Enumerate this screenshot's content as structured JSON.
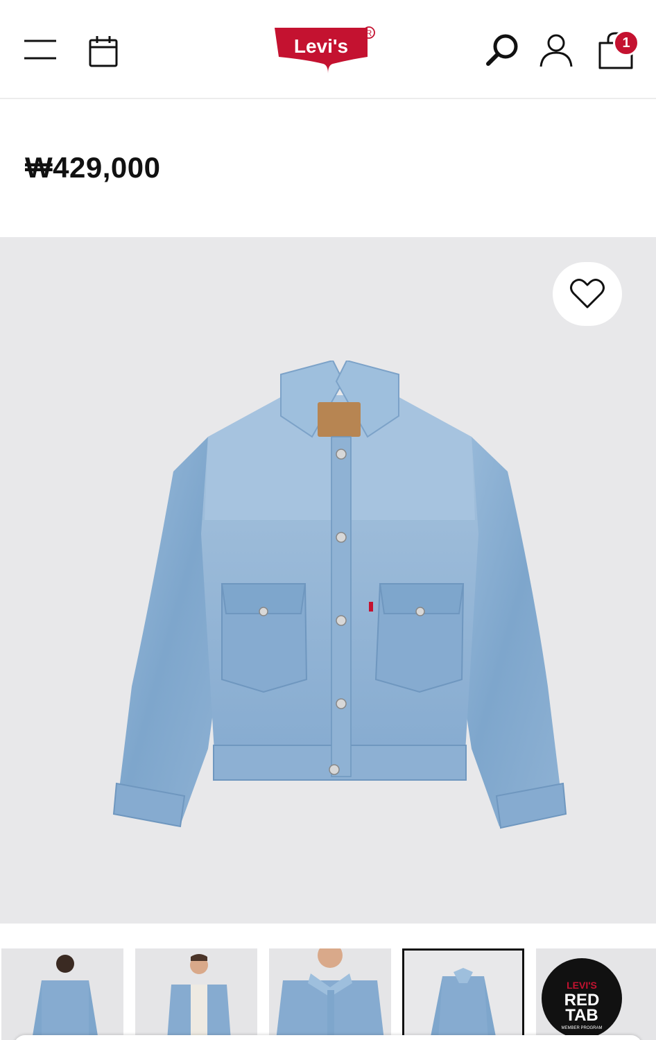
{
  "header": {
    "brand": "Levi's",
    "registered_mark": "R",
    "cart_count": "1"
  },
  "product": {
    "price": "₩429,000"
  },
  "thumbnails": {
    "redtab_line1": "LEVI'S",
    "redtab_line2": "RED",
    "redtab_line3": "TAB",
    "redtab_line4": "MEMBER PROGRAM"
  },
  "colors": {
    "brand_red": "#c41230",
    "hero_bg": "#e8e8ea",
    "denim": "#7fa6cc"
  },
  "icons": [
    "menu-icon",
    "calendar-icon",
    "search-icon",
    "account-icon",
    "shopping-bag-icon",
    "heart-icon"
  ]
}
